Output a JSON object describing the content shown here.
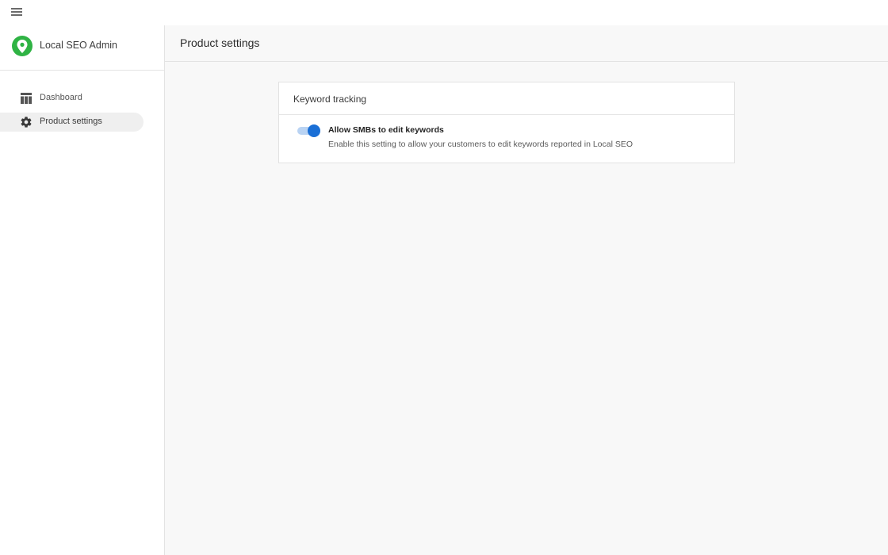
{
  "app": {
    "brand_name": "Local SEO Admin",
    "brand_color": "#2fb344"
  },
  "topbar": {
    "menu_icon": "menu-icon"
  },
  "sidebar": {
    "items": [
      {
        "label": "Dashboard",
        "icon": "dashboard-icon",
        "active": false
      },
      {
        "label": "Product settings",
        "icon": "gear-icon",
        "active": true
      }
    ]
  },
  "header": {
    "title": "Product settings"
  },
  "card": {
    "title": "Keyword tracking",
    "setting": {
      "label": "Allow SMBs to edit keywords",
      "description": "Enable this setting to allow your customers to edit keywords reported in Local SEO",
      "enabled": true,
      "accent_color": "#1a6fd6"
    }
  }
}
